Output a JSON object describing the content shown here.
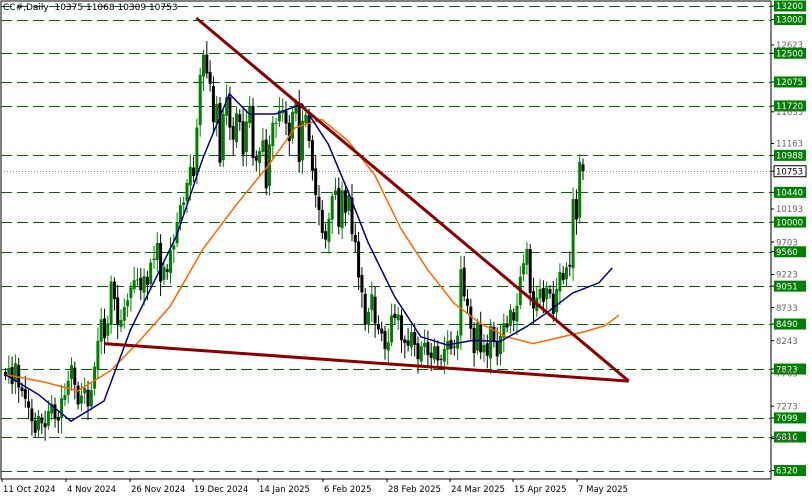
{
  "header": {
    "symbol": "CC#,Daily",
    "ohlc": "10375 11068 10309 10753"
  },
  "colors": {
    "up": "#008000",
    "down": "#000000",
    "ma_fast": "#000080",
    "ma_slow": "#ff6600",
    "trend": "#8b0000",
    "grid": "#006400",
    "tag_bg": "#008000",
    "price_bg": "#ffffff"
  },
  "chart_data": {
    "type": "candlestick",
    "title": "",
    "y_axis": {
      "min": 6230,
      "max": 13280,
      "grey_ticks": [
        12623,
        12075,
        11633,
        11163,
        10673,
        10193,
        9703,
        9223,
        8733,
        8243,
        7763,
        7273,
        6793
      ],
      "labels": [
        {
          "value": 13200,
          "text": "13200"
        },
        {
          "value": 13000,
          "text": "13000"
        },
        {
          "value": 12623,
          "text": "12623"
        },
        {
          "value": 12500,
          "text": "12500"
        },
        {
          "value": 12075,
          "text": "12075"
        },
        {
          "value": 11720,
          "text": "11720"
        },
        {
          "value": 11633,
          "text": "11633"
        },
        {
          "value": 11163,
          "text": "11163"
        },
        {
          "value": 10988,
          "text": "10988"
        },
        {
          "value": 10753,
          "text": "10753"
        },
        {
          "value": 10440,
          "text": "10440"
        },
        {
          "value": 10193,
          "text": "10193"
        },
        {
          "value": 10000,
          "text": "10000"
        },
        {
          "value": 9703,
          "text": "9703"
        },
        {
          "value": 9560,
          "text": "9560"
        },
        {
          "value": 9223,
          "text": "9223"
        },
        {
          "value": 9051,
          "text": "9051"
        },
        {
          "value": 8733,
          "text": "8733"
        },
        {
          "value": 8490,
          "text": "8490"
        },
        {
          "value": 8243,
          "text": "8243"
        },
        {
          "value": 7823,
          "text": "7823"
        },
        {
          "value": 7763,
          "text": "7763"
        },
        {
          "value": 7273,
          "text": "7273"
        },
        {
          "value": 7099,
          "text": "7099"
        },
        {
          "value": 6816,
          "text": "6816"
        },
        {
          "value": 6793,
          "text": "6793"
        },
        {
          "value": 6320,
          "text": "6320"
        }
      ],
      "levels": [
        13200,
        13000,
        12500,
        12075,
        11720,
        10988,
        10440,
        10000,
        9560,
        9051,
        8490,
        7823,
        7099,
        6816,
        6320
      ],
      "current_price": 10753
    },
    "x_axis": {
      "labels": [
        "11 Oct 2024",
        "4 Nov 2024",
        "26 Nov 2024",
        "19 Dec 2024",
        "14 Jan 2025",
        "6 Feb 2025",
        "28 Feb 2025",
        "24 Mar 2025",
        "15 Apr 2025",
        "7 May 2025"
      ]
    },
    "closes": [
      7720,
      7840,
      7600,
      7910,
      7550,
      7500,
      7380,
      7250,
      7050,
      6880,
      7130,
      7020,
      6960,
      7200,
      7310,
      7100,
      7060,
      7390,
      7440,
      7650,
      7880,
      7590,
      7300,
      7430,
      7540,
      7270,
      7510,
      7860,
      8240,
      8560,
      8280,
      8500,
      9120,
      8860,
      8480,
      8550,
      8740,
      8840,
      9030,
      9140,
      9150,
      8990,
      9200,
      9070,
      9400,
      9460,
      9690,
      9120,
      9340,
      9260,
      9580,
      9650,
      10000,
      10250,
      10290,
      10580,
      10820,
      10680,
      11400,
      12180,
      12480,
      12200,
      12050,
      11480,
      11750,
      10880,
      11600,
      11850,
      11400,
      11220,
      11610,
      11480,
      11000,
      11490,
      11720,
      10950,
      10910,
      11050,
      11210,
      10500,
      11150,
      11470,
      11470,
      11650,
      11660,
      11460,
      11200,
      11630,
      11770,
      10890,
      11500,
      11590,
      11200,
      10760,
      10400,
      10180,
      9840,
      9740,
      10050,
      10390,
      10470,
      9930,
      10470,
      10140,
      10400,
      9820,
      9700,
      9180,
      8960,
      8480,
      8670,
      8930,
      8500,
      8410,
      8350,
      8120,
      8220,
      8620,
      8580,
      8630,
      8250,
      8210,
      8170,
      8370,
      8180,
      7970,
      8160,
      8210,
      8030,
      7990,
      8160,
      7950,
      7970,
      8120,
      8240,
      8120,
      8150,
      8320,
      9300,
      8900,
      8760,
      8420,
      8060,
      8510,
      8070,
      8180,
      8020,
      8460,
      8230,
      8010,
      8310,
      8500,
      8440,
      8700,
      8540,
      8760,
      9190,
      9390,
      9600,
      8950,
      8720,
      8880,
      9010,
      8820,
      9030,
      8940,
      8640,
      9010,
      9260,
      9140,
      9330,
      9340,
      10340,
      10040,
      10890,
      10753
    ],
    "ma_fast": [
      [
        0,
        7743
      ],
      [
        10,
        7450
      ],
      [
        20,
        7050
      ],
      [
        30,
        7350
      ],
      [
        38,
        8400
      ],
      [
        44,
        9000
      ],
      [
        52,
        9800
      ],
      [
        60,
        10950
      ],
      [
        68,
        11900
      ],
      [
        74,
        11600
      ],
      [
        82,
        11600
      ],
      [
        90,
        11750
      ],
      [
        98,
        11150
      ],
      [
        104,
        10450
      ],
      [
        110,
        9700
      ],
      [
        118,
        8900
      ],
      [
        126,
        8300
      ],
      [
        134,
        8180
      ],
      [
        142,
        8250
      ],
      [
        150,
        8230
      ],
      [
        158,
        8450
      ],
      [
        164,
        8650
      ],
      [
        172,
        8950
      ],
      [
        180,
        9100
      ],
      [
        184,
        9320
      ]
    ],
    "ma_slow": [
      [
        0,
        7743
      ],
      [
        12,
        7630
      ],
      [
        22,
        7500
      ],
      [
        32,
        7800
      ],
      [
        40,
        8200
      ],
      [
        50,
        8750
      ],
      [
        60,
        9600
      ],
      [
        70,
        10250
      ],
      [
        80,
        10850
      ],
      [
        88,
        11400
      ],
      [
        96,
        11520
      ],
      [
        104,
        11200
      ],
      [
        112,
        10700
      ],
      [
        120,
        9900
      ],
      [
        128,
        9300
      ],
      [
        136,
        8800
      ],
      [
        144,
        8500
      ],
      [
        152,
        8300
      ],
      [
        160,
        8200
      ],
      [
        168,
        8290
      ],
      [
        176,
        8380
      ],
      [
        182,
        8470
      ],
      [
        186,
        8620
      ]
    ],
    "trendlines": [
      {
        "from": [
          58,
          13020
        ],
        "to": [
          189,
          7645
        ]
      },
      {
        "from": [
          30,
          8200
        ],
        "to": [
          189,
          7645
        ]
      }
    ]
  }
}
